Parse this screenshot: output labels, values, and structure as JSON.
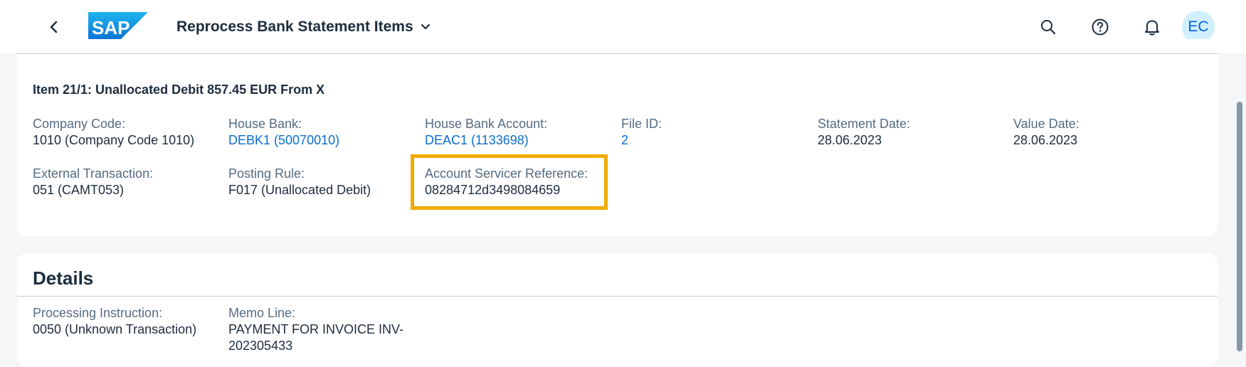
{
  "shell": {
    "app_title": "Reprocess Bank Statement Items",
    "logo_text": "SAP",
    "avatar_initials": "EC",
    "icons": [
      "back-icon",
      "search-icon",
      "help-icon",
      "notification-bell-icon"
    ],
    "brand_color": "#0a6ed1"
  },
  "header_card": {
    "title": "Item 21/1: Unallocated Debit 857.45 EUR From X",
    "fields": {
      "company_code": {
        "label": "Company Code:",
        "value": "1010 (Company Code 1010)"
      },
      "house_bank": {
        "label": "House Bank:",
        "value": "DEBK1 (50070010)"
      },
      "house_bank_account": {
        "label": "House Bank Account:",
        "value": "DEAC1 (1133698)"
      },
      "file_id": {
        "label": "File ID:",
        "value": "2"
      },
      "statement_date": {
        "label": "Statement Date:",
        "value": "28.06.2023"
      },
      "value_date": {
        "label": "Value Date:",
        "value": "28.06.2023"
      },
      "external_transaction": {
        "label": "External Transaction:",
        "value": "051 (CAMT053)"
      },
      "posting_rule": {
        "label": "Posting Rule:",
        "value": "F017 (Unallocated Debit)"
      },
      "account_servicer_reference": {
        "label": "Account Servicer Reference:",
        "value": "08284712d3498084659"
      }
    },
    "highlight_color": "#f0ab00"
  },
  "details_card": {
    "heading": "Details",
    "fields": {
      "processing_instruction": {
        "label": "Processing Instruction:",
        "value": "0050 (Unknown Transaction)"
      },
      "memo_line": {
        "label": "Memo Line:",
        "value_line1": "PAYMENT FOR INVOICE INV-",
        "value_line2": "202305433"
      }
    }
  }
}
